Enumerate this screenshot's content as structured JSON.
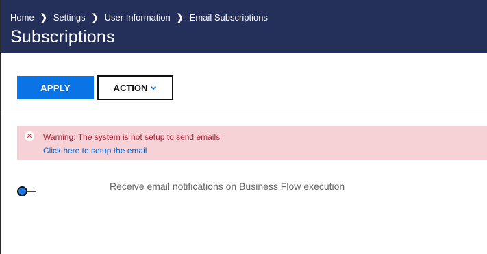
{
  "header": {
    "breadcrumb": [
      "Home",
      "Settings",
      "User Information",
      "Email Subscriptions"
    ],
    "title": "Subscriptions"
  },
  "toolbar": {
    "apply_label": "APPLY",
    "action_label": "ACTION"
  },
  "warning": {
    "message": "Warning: The system is not setup to send emails",
    "link": "Click here to setup the email",
    "icon": "x-circle-icon",
    "background": "#f6d2d6",
    "text_color": "#b0233a"
  },
  "subscription": {
    "label": "Receive email notifications on Business Flow execution",
    "enabled": false
  },
  "colors": {
    "header_bg": "#25305a",
    "accent": "#0a73e6"
  }
}
